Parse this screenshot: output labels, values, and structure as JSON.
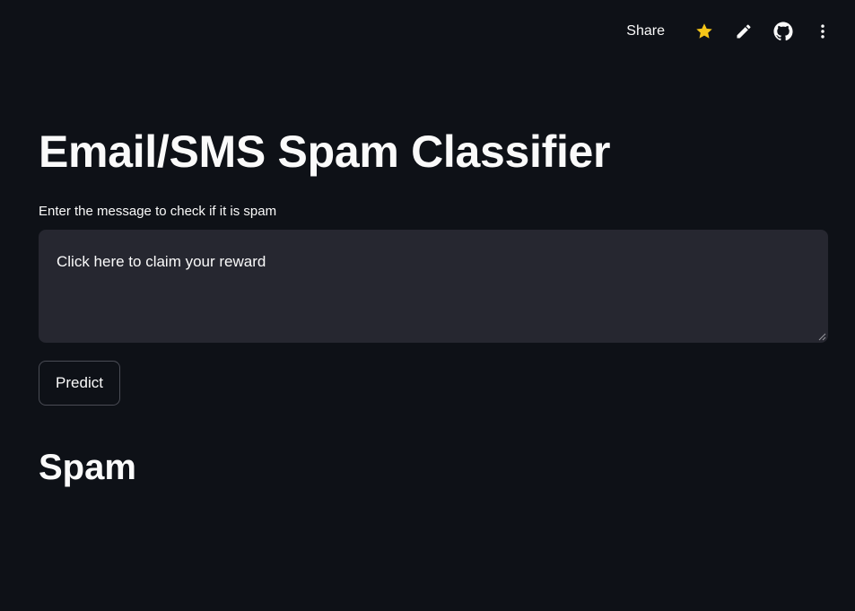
{
  "toolbar": {
    "share_label": "Share",
    "icons": [
      "star-icon",
      "pencil-icon",
      "github-icon",
      "more-vertical-icon"
    ],
    "star_color": "#f5c518"
  },
  "main": {
    "title": "Email/SMS Spam Classifier",
    "input_label": "Enter the message to check if it is spam",
    "input_value": "Click here to claim your reward",
    "predict_label": "Predict",
    "result": "Spam"
  },
  "colors": {
    "background": "#0e1117",
    "input_background": "#262730",
    "text": "#fafafa",
    "button_border": "#4a4c55"
  }
}
